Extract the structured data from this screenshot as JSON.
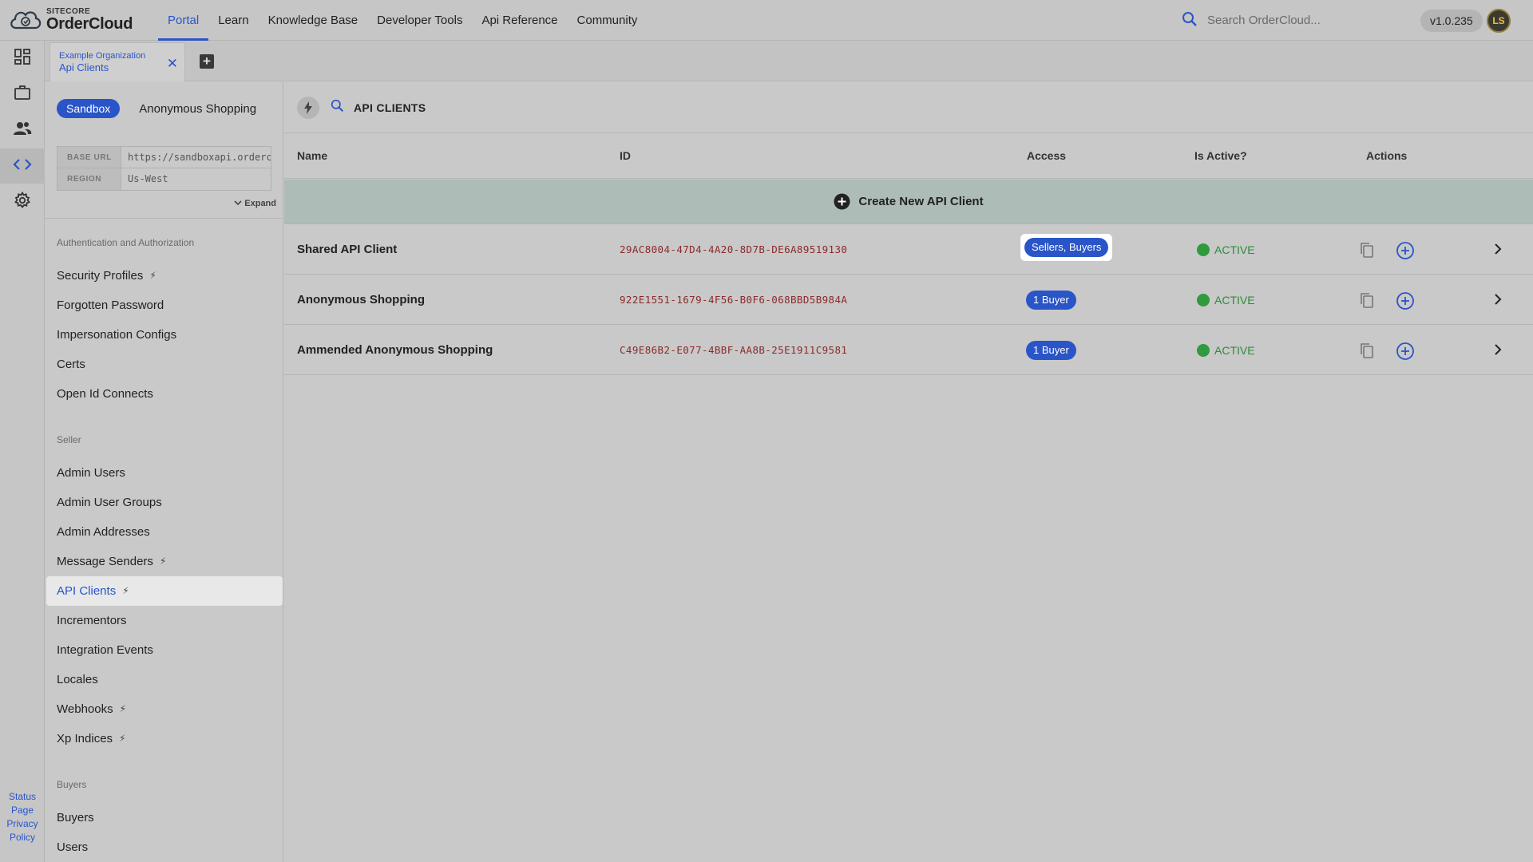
{
  "brand": {
    "small": "SITECORE",
    "main": "OrderCloud"
  },
  "nav": [
    {
      "label": "Portal",
      "active": true
    },
    {
      "label": "Learn"
    },
    {
      "label": "Knowledge Base"
    },
    {
      "label": "Developer Tools"
    },
    {
      "label": "Api Reference"
    },
    {
      "label": "Community"
    }
  ],
  "search": {
    "placeholder": "Search OrderCloud..."
  },
  "version": "v1.0.235",
  "avatar": {
    "initials": "LS"
  },
  "rail": {
    "icons": [
      "dashboard-icon",
      "briefcase-icon",
      "users-icon",
      "code-icon",
      "settings-icon"
    ],
    "footer": [
      "Status",
      "Page",
      "Privacy",
      "Policy"
    ]
  },
  "tab": {
    "org": "Example Organization",
    "title": "Api Clients",
    "close": "✕",
    "add": "+"
  },
  "panel": {
    "env_badge": "Sandbox",
    "env_name": "Anonymous Shopping",
    "base_url_label": "BASE URL",
    "base_url": "https://sandboxapi.ordercloud.io",
    "region_label": "REGION",
    "region": "Us-West",
    "expand": "Expand",
    "sections": {
      "auth": "Authentication and Authorization",
      "seller": "Seller",
      "buyers": "Buyers"
    },
    "auth_items": [
      "Security Profiles",
      "Forgotten Password",
      "Impersonation Configs",
      "Certs",
      "Open Id Connects"
    ],
    "seller_items": [
      "Admin Users",
      "Admin User Groups",
      "Admin Addresses",
      "Message Senders",
      "API Clients",
      "Incrementors",
      "Integration Events",
      "Locales",
      "Webhooks",
      "Xp Indices"
    ],
    "buyer_items": [
      "Buyers",
      "Users"
    ]
  },
  "main": {
    "title": "API CLIENTS",
    "columns": {
      "name": "Name",
      "id": "ID",
      "access": "Access",
      "active": "Is Active?",
      "actions": "Actions"
    },
    "create_label": "Create New API Client",
    "rows": [
      {
        "name": "Shared API Client",
        "id": "29AC8004-47D4-4A20-8D7B-DE6A89519130",
        "access": "Sellers, Buyers",
        "status": "ACTIVE"
      },
      {
        "name": "Anonymous Shopping",
        "id": "922E1551-1679-4F56-B0F6-068BBD5B984A",
        "access": "1 Buyer",
        "status": "ACTIVE"
      },
      {
        "name": "Ammended Anonymous Shopping",
        "id": "C49E86B2-E077-4BBF-AA8B-25E1911C9581",
        "access": "1 Buyer",
        "status": "ACTIVE"
      }
    ]
  },
  "colors": {
    "accent": "#2a55c8",
    "active_green": "#2f9a3e",
    "create_row_bg": "#adbcb7"
  }
}
